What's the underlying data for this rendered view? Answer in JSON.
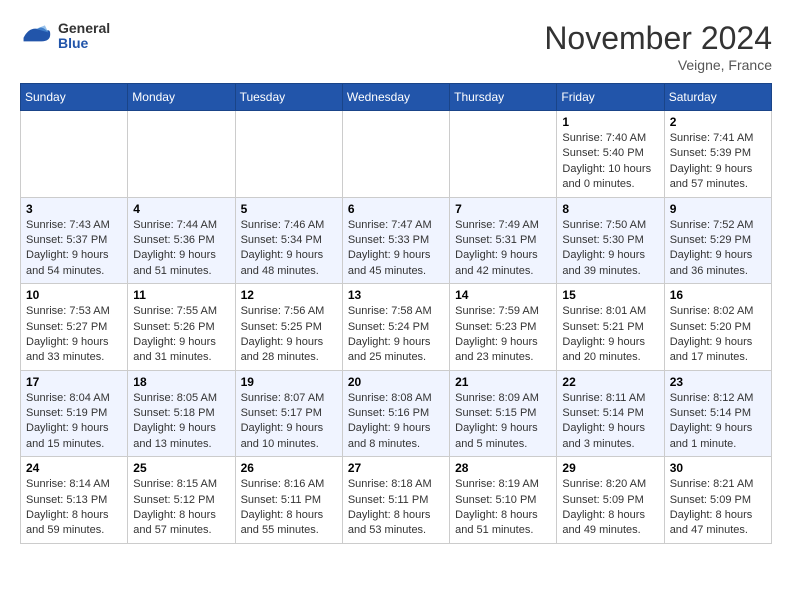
{
  "header": {
    "logo": {
      "general": "General",
      "blue": "Blue"
    },
    "title": "November 2024",
    "location": "Veigne, France"
  },
  "weekdays": [
    "Sunday",
    "Monday",
    "Tuesday",
    "Wednesday",
    "Thursday",
    "Friday",
    "Saturday"
  ],
  "weeks": [
    [
      {
        "day": "",
        "sunrise": "",
        "sunset": "",
        "daylight": ""
      },
      {
        "day": "",
        "sunrise": "",
        "sunset": "",
        "daylight": ""
      },
      {
        "day": "",
        "sunrise": "",
        "sunset": "",
        "daylight": ""
      },
      {
        "day": "",
        "sunrise": "",
        "sunset": "",
        "daylight": ""
      },
      {
        "day": "",
        "sunrise": "",
        "sunset": "",
        "daylight": ""
      },
      {
        "day": "1",
        "sunrise": "Sunrise: 7:40 AM",
        "sunset": "Sunset: 5:40 PM",
        "daylight": "Daylight: 10 hours and 0 minutes."
      },
      {
        "day": "2",
        "sunrise": "Sunrise: 7:41 AM",
        "sunset": "Sunset: 5:39 PM",
        "daylight": "Daylight: 9 hours and 57 minutes."
      }
    ],
    [
      {
        "day": "3",
        "sunrise": "Sunrise: 7:43 AM",
        "sunset": "Sunset: 5:37 PM",
        "daylight": "Daylight: 9 hours and 54 minutes."
      },
      {
        "day": "4",
        "sunrise": "Sunrise: 7:44 AM",
        "sunset": "Sunset: 5:36 PM",
        "daylight": "Daylight: 9 hours and 51 minutes."
      },
      {
        "day": "5",
        "sunrise": "Sunrise: 7:46 AM",
        "sunset": "Sunset: 5:34 PM",
        "daylight": "Daylight: 9 hours and 48 minutes."
      },
      {
        "day": "6",
        "sunrise": "Sunrise: 7:47 AM",
        "sunset": "Sunset: 5:33 PM",
        "daylight": "Daylight: 9 hours and 45 minutes."
      },
      {
        "day": "7",
        "sunrise": "Sunrise: 7:49 AM",
        "sunset": "Sunset: 5:31 PM",
        "daylight": "Daylight: 9 hours and 42 minutes."
      },
      {
        "day": "8",
        "sunrise": "Sunrise: 7:50 AM",
        "sunset": "Sunset: 5:30 PM",
        "daylight": "Daylight: 9 hours and 39 minutes."
      },
      {
        "day": "9",
        "sunrise": "Sunrise: 7:52 AM",
        "sunset": "Sunset: 5:29 PM",
        "daylight": "Daylight: 9 hours and 36 minutes."
      }
    ],
    [
      {
        "day": "10",
        "sunrise": "Sunrise: 7:53 AM",
        "sunset": "Sunset: 5:27 PM",
        "daylight": "Daylight: 9 hours and 33 minutes."
      },
      {
        "day": "11",
        "sunrise": "Sunrise: 7:55 AM",
        "sunset": "Sunset: 5:26 PM",
        "daylight": "Daylight: 9 hours and 31 minutes."
      },
      {
        "day": "12",
        "sunrise": "Sunrise: 7:56 AM",
        "sunset": "Sunset: 5:25 PM",
        "daylight": "Daylight: 9 hours and 28 minutes."
      },
      {
        "day": "13",
        "sunrise": "Sunrise: 7:58 AM",
        "sunset": "Sunset: 5:24 PM",
        "daylight": "Daylight: 9 hours and 25 minutes."
      },
      {
        "day": "14",
        "sunrise": "Sunrise: 7:59 AM",
        "sunset": "Sunset: 5:23 PM",
        "daylight": "Daylight: 9 hours and 23 minutes."
      },
      {
        "day": "15",
        "sunrise": "Sunrise: 8:01 AM",
        "sunset": "Sunset: 5:21 PM",
        "daylight": "Daylight: 9 hours and 20 minutes."
      },
      {
        "day": "16",
        "sunrise": "Sunrise: 8:02 AM",
        "sunset": "Sunset: 5:20 PM",
        "daylight": "Daylight: 9 hours and 17 minutes."
      }
    ],
    [
      {
        "day": "17",
        "sunrise": "Sunrise: 8:04 AM",
        "sunset": "Sunset: 5:19 PM",
        "daylight": "Daylight: 9 hours and 15 minutes."
      },
      {
        "day": "18",
        "sunrise": "Sunrise: 8:05 AM",
        "sunset": "Sunset: 5:18 PM",
        "daylight": "Daylight: 9 hours and 13 minutes."
      },
      {
        "day": "19",
        "sunrise": "Sunrise: 8:07 AM",
        "sunset": "Sunset: 5:17 PM",
        "daylight": "Daylight: 9 hours and 10 minutes."
      },
      {
        "day": "20",
        "sunrise": "Sunrise: 8:08 AM",
        "sunset": "Sunset: 5:16 PM",
        "daylight": "Daylight: 9 hours and 8 minutes."
      },
      {
        "day": "21",
        "sunrise": "Sunrise: 8:09 AM",
        "sunset": "Sunset: 5:15 PM",
        "daylight": "Daylight: 9 hours and 5 minutes."
      },
      {
        "day": "22",
        "sunrise": "Sunrise: 8:11 AM",
        "sunset": "Sunset: 5:14 PM",
        "daylight": "Daylight: 9 hours and 3 minutes."
      },
      {
        "day": "23",
        "sunrise": "Sunrise: 8:12 AM",
        "sunset": "Sunset: 5:14 PM",
        "daylight": "Daylight: 9 hours and 1 minute."
      }
    ],
    [
      {
        "day": "24",
        "sunrise": "Sunrise: 8:14 AM",
        "sunset": "Sunset: 5:13 PM",
        "daylight": "Daylight: 8 hours and 59 minutes."
      },
      {
        "day": "25",
        "sunrise": "Sunrise: 8:15 AM",
        "sunset": "Sunset: 5:12 PM",
        "daylight": "Daylight: 8 hours and 57 minutes."
      },
      {
        "day": "26",
        "sunrise": "Sunrise: 8:16 AM",
        "sunset": "Sunset: 5:11 PM",
        "daylight": "Daylight: 8 hours and 55 minutes."
      },
      {
        "day": "27",
        "sunrise": "Sunrise: 8:18 AM",
        "sunset": "Sunset: 5:11 PM",
        "daylight": "Daylight: 8 hours and 53 minutes."
      },
      {
        "day": "28",
        "sunrise": "Sunrise: 8:19 AM",
        "sunset": "Sunset: 5:10 PM",
        "daylight": "Daylight: 8 hours and 51 minutes."
      },
      {
        "day": "29",
        "sunrise": "Sunrise: 8:20 AM",
        "sunset": "Sunset: 5:09 PM",
        "daylight": "Daylight: 8 hours and 49 minutes."
      },
      {
        "day": "30",
        "sunrise": "Sunrise: 8:21 AM",
        "sunset": "Sunset: 5:09 PM",
        "daylight": "Daylight: 8 hours and 47 minutes."
      }
    ]
  ]
}
